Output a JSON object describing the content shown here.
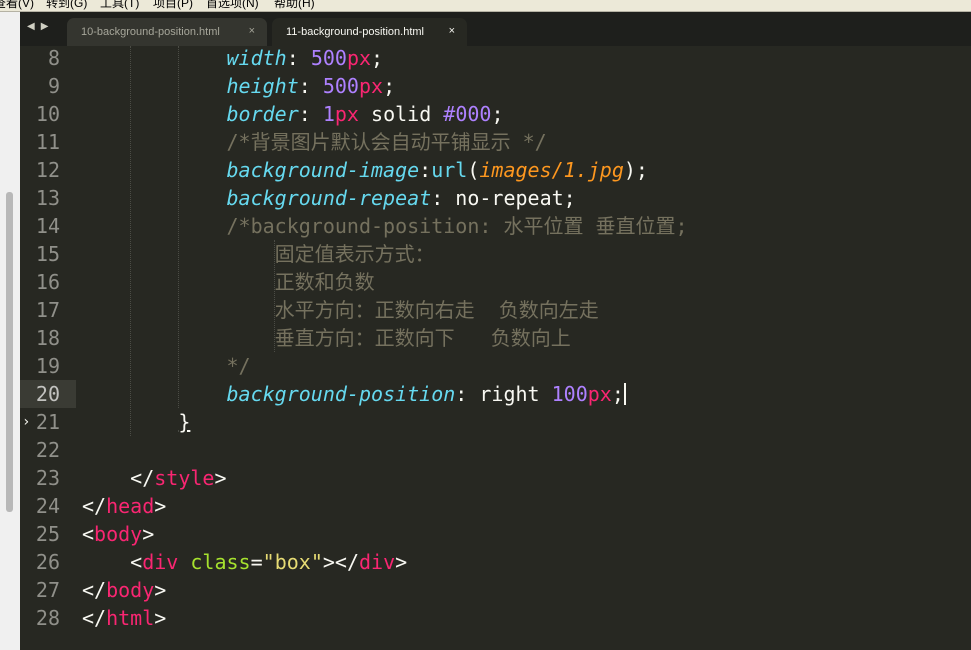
{
  "menubar": {
    "items": [
      "查看(V)",
      "转到(G)",
      "工具(T)",
      "项目(P)",
      "首选项(N)",
      "帮助(H)"
    ]
  },
  "tabs": [
    {
      "label": "10-background-position.html",
      "close": "×",
      "active": false
    },
    {
      "label": "11-background-position.html",
      "close": "×",
      "active": true
    }
  ],
  "nav": {
    "back": "◀",
    "forward": "▶"
  },
  "editor": {
    "current_line": 20,
    "lines": [
      {
        "n": "8",
        "tokens": [
          {
            "t": "            "
          },
          {
            "t": "width",
            "c": "kw"
          },
          {
            "t": ": "
          },
          {
            "t": "500",
            "c": "num"
          },
          {
            "t": "px",
            "c": "unit"
          },
          {
            "t": ";"
          }
        ]
      },
      {
        "n": "9",
        "tokens": [
          {
            "t": "            "
          },
          {
            "t": "height",
            "c": "kw"
          },
          {
            "t": ": "
          },
          {
            "t": "500",
            "c": "num"
          },
          {
            "t": "px",
            "c": "unit"
          },
          {
            "t": ";"
          }
        ]
      },
      {
        "n": "10",
        "tokens": [
          {
            "t": "            "
          },
          {
            "t": "border",
            "c": "kw"
          },
          {
            "t": ": "
          },
          {
            "t": "1",
            "c": "num"
          },
          {
            "t": "px",
            "c": "unit"
          },
          {
            "t": " solid "
          },
          {
            "t": "#000",
            "c": "num"
          },
          {
            "t": ";"
          }
        ]
      },
      {
        "n": "11",
        "tokens": [
          {
            "t": "            "
          },
          {
            "t": "/*背景图片默认会自动平铺显示 */",
            "c": "cmt"
          }
        ]
      },
      {
        "n": "12",
        "tokens": [
          {
            "t": "            "
          },
          {
            "t": "background-image",
            "c": "kw"
          },
          {
            "t": ":"
          },
          {
            "t": "url",
            "c": "fn"
          },
          {
            "t": "("
          },
          {
            "t": "images/1.jpg",
            "c": "url"
          },
          {
            "t": ");"
          }
        ]
      },
      {
        "n": "13",
        "tokens": [
          {
            "t": "            "
          },
          {
            "t": "background-repeat",
            "c": "kw"
          },
          {
            "t": ": no-repeat;"
          }
        ]
      },
      {
        "n": "14",
        "tokens": [
          {
            "t": "            "
          },
          {
            "t": "/*background-position: 水平位置 垂直位置;",
            "c": "cmt"
          }
        ]
      },
      {
        "n": "15",
        "tokens": [
          {
            "t": "                "
          },
          {
            "t": "固定值表示方式：",
            "c": "cmt"
          }
        ]
      },
      {
        "n": "16",
        "tokens": [
          {
            "t": "                "
          },
          {
            "t": "正数和负数",
            "c": "cmt"
          }
        ]
      },
      {
        "n": "17",
        "tokens": [
          {
            "t": "                "
          },
          {
            "t": "水平方向：正数向右走  负数向左走",
            "c": "cmt"
          }
        ]
      },
      {
        "n": "18",
        "tokens": [
          {
            "t": "                "
          },
          {
            "t": "垂直方向：正数向下   负数向上",
            "c": "cmt"
          }
        ]
      },
      {
        "n": "19",
        "tokens": [
          {
            "t": "            "
          },
          {
            "t": "*/",
            "c": "cmt"
          }
        ]
      },
      {
        "n": "20",
        "tokens": [
          {
            "t": "            "
          },
          {
            "t": "background-position",
            "c": "kw"
          },
          {
            "t": ": right "
          },
          {
            "t": "100",
            "c": "num"
          },
          {
            "t": "px",
            "c": "unit"
          },
          {
            "t": ";"
          }
        ],
        "caret": true
      },
      {
        "n": "21",
        "tokens": [
          {
            "t": "        "
          },
          {
            "t": "}",
            "c": "ul"
          }
        ]
      },
      {
        "n": "22",
        "tokens": []
      },
      {
        "n": "23",
        "tokens": [
          {
            "t": "    </"
          },
          {
            "t": "style",
            "c": "tag"
          },
          {
            "t": ">"
          }
        ]
      },
      {
        "n": "24",
        "tokens": [
          {
            "t": "</"
          },
          {
            "t": "head",
            "c": "tag"
          },
          {
            "t": ">"
          }
        ]
      },
      {
        "n": "25",
        "tokens": [
          {
            "t": "<"
          },
          {
            "t": "body",
            "c": "tag"
          },
          {
            "t": ">"
          }
        ]
      },
      {
        "n": "26",
        "tokens": [
          {
            "t": "    <"
          },
          {
            "t": "div",
            "c": "tag"
          },
          {
            "t": " "
          },
          {
            "t": "class",
            "c": "attr"
          },
          {
            "t": "="
          },
          {
            "t": "\"box\"",
            "c": "str"
          },
          {
            "t": "></"
          },
          {
            "t": "div",
            "c": "tag"
          },
          {
            "t": ">"
          }
        ]
      },
      {
        "n": "27",
        "tokens": [
          {
            "t": "</"
          },
          {
            "t": "body",
            "c": "tag"
          },
          {
            "t": ">"
          }
        ]
      },
      {
        "n": "28",
        "tokens": [
          {
            "t": "</"
          },
          {
            "t": "html",
            "c": "tag"
          },
          {
            "t": ">"
          }
        ]
      }
    ]
  },
  "colors": {
    "background": "#272822",
    "keyword": "#66d9ef",
    "number": "#ae81ff",
    "tag": "#f92672",
    "attribute": "#a6e22e",
    "string": "#e6db74",
    "comment": "#75715e",
    "url": "#fd971f"
  },
  "icons": {
    "fold_marker": "fold-arrow-icon"
  }
}
